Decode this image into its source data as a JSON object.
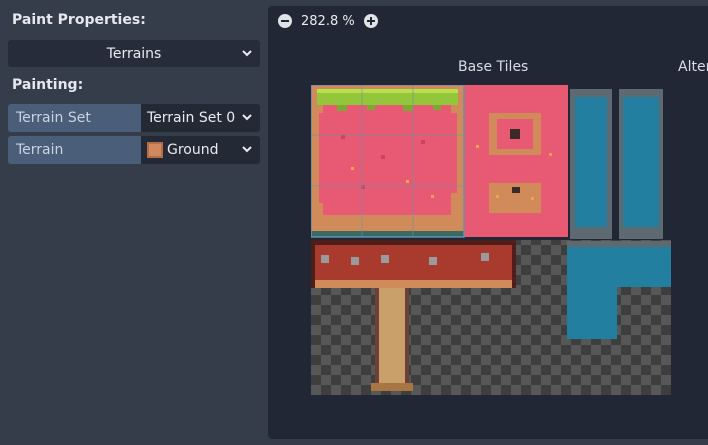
{
  "paint_properties": {
    "title": "Paint Properties:",
    "mode_value": "Terrains"
  },
  "painting": {
    "title": "Painting:",
    "terrain_set": {
      "label": "Terrain Set",
      "value": "Terrain Set 0"
    },
    "terrain": {
      "label": "Terrain",
      "value": "Ground",
      "swatch_color": "#d0885e"
    }
  },
  "atlas": {
    "zoom": "282.8 %",
    "base_tiles_label": "Base Tiles",
    "alternative_label": "Alter"
  },
  "colors": {
    "panel": "#363d4a",
    "editor_bg": "#212735",
    "grass": "#93c63a",
    "pink": "#e85a74",
    "dirt": "#d18a5a",
    "water": "#237f9f",
    "lava": "#a83a2e",
    "selection": "#6b8fa8"
  }
}
